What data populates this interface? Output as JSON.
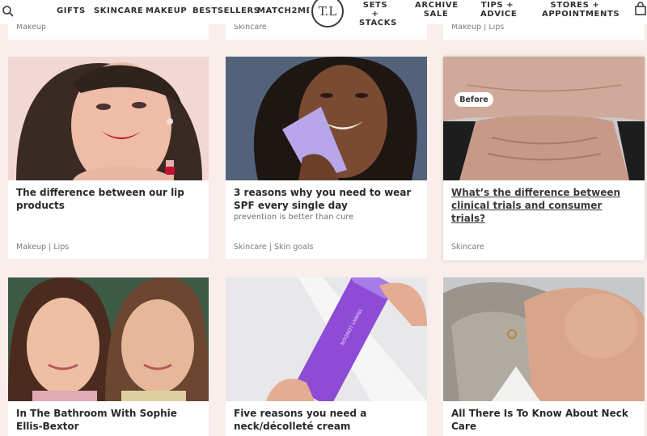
{
  "nav": {
    "gifts": "GIFTS",
    "skincare": "SKINCARE",
    "makeup": "MAKEUP",
    "bestsellers": "BESTSELLERS",
    "match2me": "MATCH2ME",
    "logo": "T.L",
    "sets_line1": "SETS +",
    "sets_line2": "STACKS",
    "archive_line1": "ARCHIVE",
    "archive_line2": "SALE",
    "tips_line1": "TIPS +",
    "tips_line2": "ADVICE",
    "stores_line1": "STORES +",
    "stores_line2": "APPOINTMENTS"
  },
  "top_cards": [
    {
      "tag": "Makeup"
    },
    {
      "tag": "Skincare"
    },
    {
      "tag": "Makeup | Lips"
    }
  ],
  "cards": [
    {
      "title": "The difference between our lip products",
      "subtitle": "",
      "tag": "Makeup | Lips"
    },
    {
      "title": "3 reasons why you need to wear SPF every single day",
      "subtitle": "prevention is better than cure",
      "tag": "Skincare | Skin goals"
    },
    {
      "title": "What’s the difference between clinical trials and consumer trials?",
      "subtitle": "",
      "tag": "Skincare",
      "badge": "Before"
    },
    {
      "title": "In The Bathroom With Sophie Ellis-Bextor",
      "subtitle": "",
      "tag": ""
    },
    {
      "title": "Five reasons you need a neck/décolleté cream",
      "subtitle": "",
      "tag": "",
      "product_text": "TRINNY LONDON"
    },
    {
      "title": "All There Is To Know About Neck Care",
      "subtitle": "",
      "tag": ""
    }
  ],
  "colors": {
    "page_bg": "#f9eeec",
    "card_bg": "#ffffff",
    "text": "#2b2b2b",
    "tag": "#7a7a7a"
  }
}
